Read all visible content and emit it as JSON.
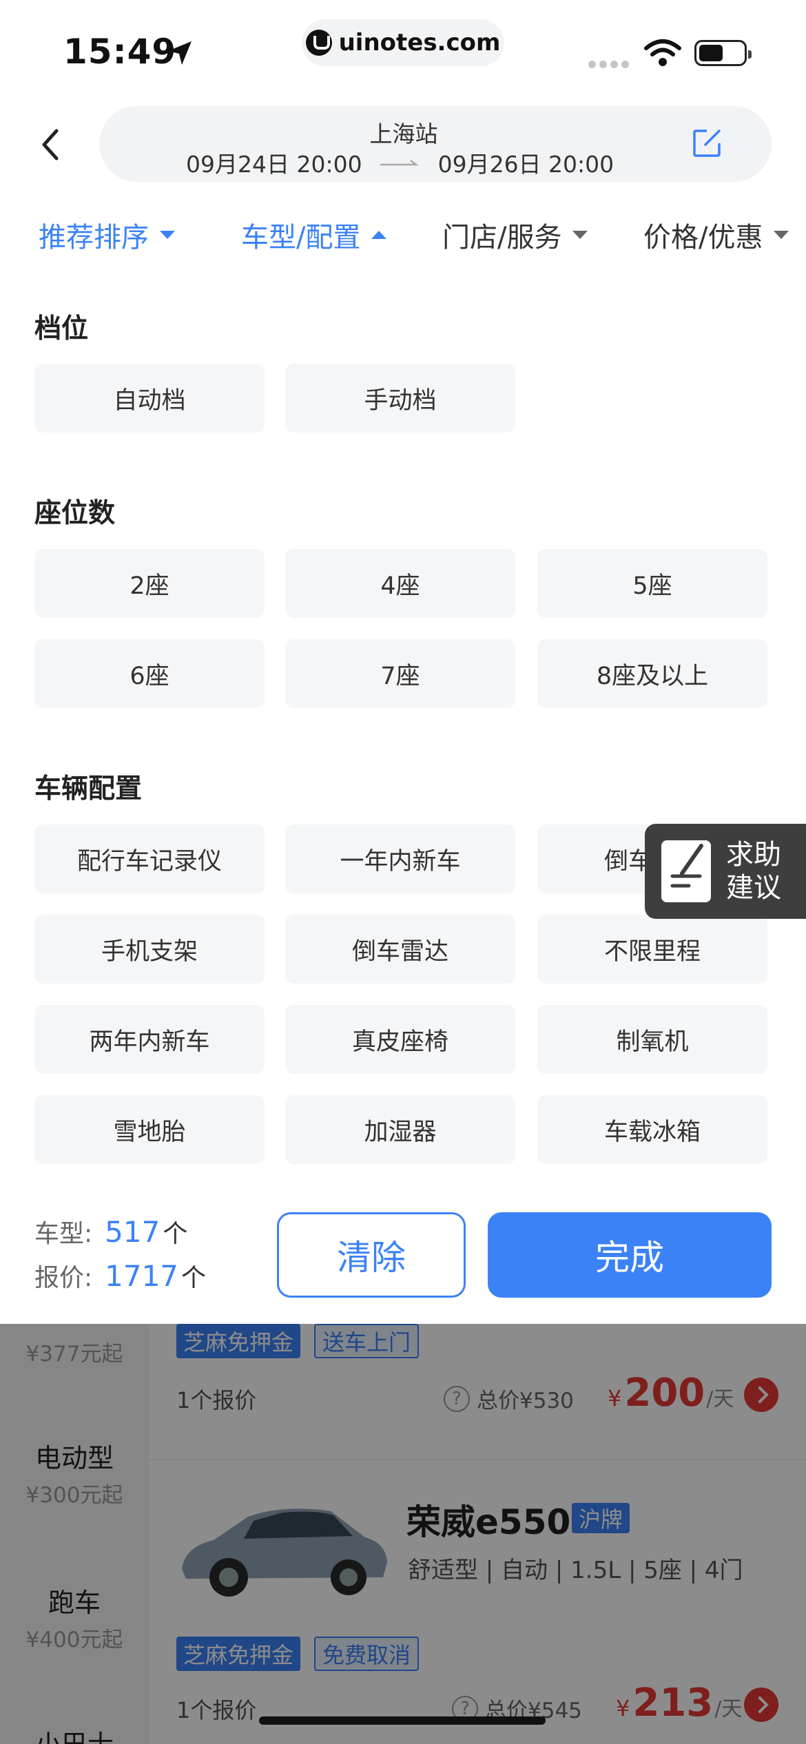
{
  "status_bar": {
    "time": "15:49",
    "url": "uinotes.com"
  },
  "header": {
    "station": "上海站",
    "pickup": "09月24日 20:00",
    "dropoff": "09月26日 20:00"
  },
  "tabs": [
    {
      "label": "推荐排序"
    },
    {
      "label": "车型/配置"
    },
    {
      "label": "门店/服务"
    },
    {
      "label": "价格/优惠"
    }
  ],
  "filters": {
    "transmission": {
      "title": "档位",
      "options": [
        "自动档",
        "手动档"
      ]
    },
    "seats": {
      "title": "座位数",
      "options": [
        "2座",
        "4座",
        "5座",
        "6座",
        "7座",
        "8座及以上"
      ]
    },
    "config": {
      "title": "车辆配置",
      "options": [
        "配行车记录仪",
        "一年内新车",
        "倒车影像",
        "手机支架",
        "倒车雷达",
        "不限里程",
        "两年内新车",
        "真皮座椅",
        "制氧机",
        "雪地胎",
        "加湿器",
        "车载冰箱"
      ]
    }
  },
  "help_float": {
    "line1": "求助",
    "line2": "建议"
  },
  "action_bar": {
    "model_label": "车型:",
    "model_count": "517",
    "quote_label": "报价:",
    "quote_count": "1717",
    "unit": "个",
    "clear_label": "清除",
    "done_label": "完成"
  },
  "background_list": {
    "sidebar": [
      {
        "name": "",
        "price": "¥377元起"
      },
      {
        "name": "电动型",
        "price": "¥300元起"
      },
      {
        "name": "跑车",
        "price": "¥400元起"
      },
      {
        "name": "小巴士",
        "price": ""
      }
    ],
    "cards": [
      {
        "tags": [
          "芝麻免押金",
          "送车上门"
        ],
        "quote_count": "1个报价",
        "total": "总价¥530",
        "currency": "¥",
        "price": "200",
        "per": "/天"
      },
      {
        "name": "荣威e550",
        "plate": "沪牌",
        "spec": "舒适型 | 自动 | 1.5L | 5座 | 4门",
        "tags": [
          "芝麻免押金",
          "免费取消"
        ],
        "quote_count": "1个报价",
        "total": "总价¥545",
        "currency": "¥",
        "price": "213",
        "per": "/天"
      }
    ]
  },
  "colors": {
    "accent": "#3b82f6",
    "price": "#e53935"
  }
}
